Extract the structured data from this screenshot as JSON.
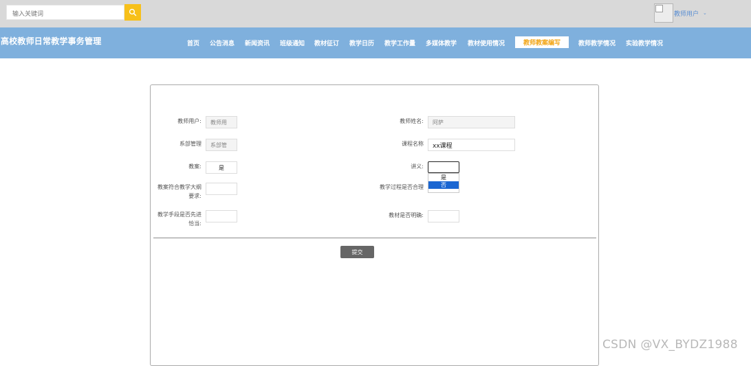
{
  "search": {
    "placeholder": "输入关键词"
  },
  "user": {
    "name": "教师用户",
    "caret": "⌄"
  },
  "site": {
    "title": "高校教师日常教学事务管理"
  },
  "nav": {
    "items": [
      "首页",
      "公告消息",
      "新闻资讯",
      "班级通知",
      "教材征订",
      "教学日历",
      "教学工作量",
      "多媒体教学",
      "教材使用情况",
      "教师教案编写",
      "教师教学情况",
      "实验教学情况"
    ],
    "active_index": 9
  },
  "form": {
    "teacher_user": {
      "label": "教师用户:",
      "value": "教师用"
    },
    "teacher_name": {
      "label": "教师姓名:",
      "value": "阿萨"
    },
    "department": {
      "label": "系部管理",
      "value": "系部管"
    },
    "course_name": {
      "label": "课程名称",
      "value": "xx课程"
    },
    "lesson_plan": {
      "label": "教案:",
      "value": "是"
    },
    "handout": {
      "label": "讲义:",
      "options": [
        "是",
        "否"
      ],
      "highlighted": "否"
    },
    "syllabus_conform": {
      "label_line1": "教案符合教学大纲",
      "label_line2": "要求:"
    },
    "process_reasonable": {
      "label": "教学过程是否合理"
    },
    "method_advanced": {
      "label_line1": "教学手段是否先进",
      "label_line2": "恰当:"
    },
    "textbook_clear": {
      "label": "教材是否明确:"
    },
    "submit_label": "提交"
  },
  "watermark": "CSDN @VX_BYDZ1988",
  "colors": {
    "nav_bg": "#7fb0dd",
    "topbar_bg": "#d9d9d9",
    "search_btn": "#f7c01a",
    "active_text": "#f2a516",
    "submit_bg": "#666666"
  }
}
